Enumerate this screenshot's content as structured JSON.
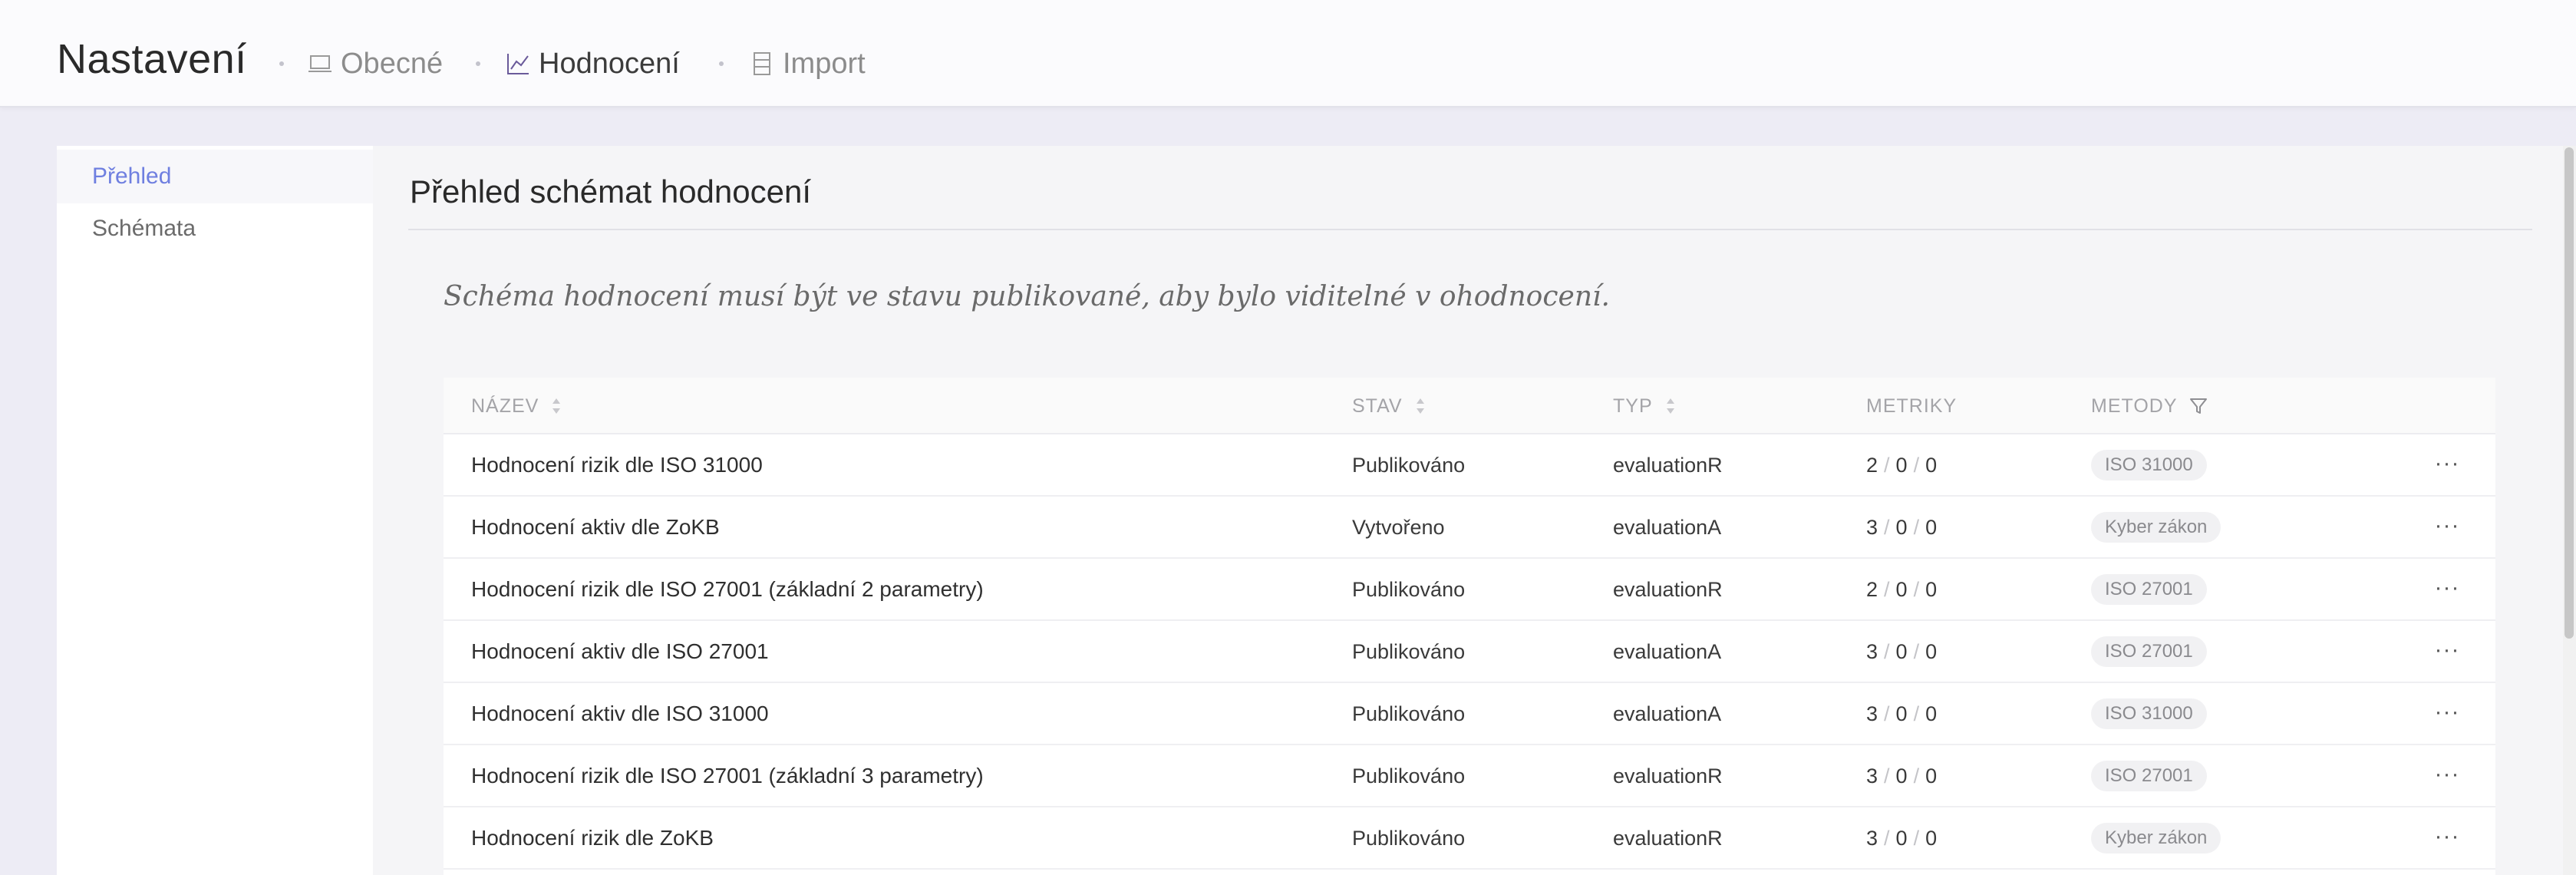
{
  "app": {
    "title": "Nastavení",
    "nav": [
      {
        "label": "Obecné",
        "icon": "laptop-icon",
        "active": false
      },
      {
        "label": "Hodnocení",
        "icon": "line-chart-icon",
        "active": true
      },
      {
        "label": "Import",
        "icon": "server-icon",
        "active": false
      }
    ]
  },
  "sidebar": {
    "items": [
      {
        "label": "Přehled",
        "active": true
      },
      {
        "label": "Schémata",
        "active": false
      }
    ]
  },
  "main": {
    "title": "Přehled schémat hodnocení",
    "notice": "Schéma hodnocení musí být ve stavu publikované, aby bylo viditelné v ohodnocení."
  },
  "table": {
    "columns": {
      "name": "NÁZEV",
      "status": "STAV",
      "type": "TYP",
      "metrics": "METRIKY",
      "methods": "METODY"
    },
    "rows": [
      {
        "name": "Hodnocení rizik dle ISO 31000",
        "status": "Publikováno",
        "type": "evaluationR",
        "m1": "2",
        "m2": "0",
        "m3": "0",
        "method": "ISO 31000",
        "more": "···"
      },
      {
        "name": "Hodnocení aktiv dle ZoKB",
        "status": "Vytvořeno",
        "type": "evaluationA",
        "m1": "3",
        "m2": "0",
        "m3": "0",
        "method": "Kyber zákon",
        "more": "···"
      },
      {
        "name": "Hodnocení rizik dle ISO 27001 (základní 2 parametry)",
        "status": "Publikováno",
        "type": "evaluationR",
        "m1": "2",
        "m2": "0",
        "m3": "0",
        "method": "ISO 27001",
        "more": "···"
      },
      {
        "name": "Hodnocení aktiv dle ISO 27001",
        "status": "Publikováno",
        "type": "evaluationA",
        "m1": "3",
        "m2": "0",
        "m3": "0",
        "method": "ISO 27001",
        "more": "···"
      },
      {
        "name": "Hodnocení aktiv dle ISO 31000",
        "status": "Publikováno",
        "type": "evaluationA",
        "m1": "3",
        "m2": "0",
        "m3": "0",
        "method": "ISO 31000",
        "more": "···"
      },
      {
        "name": "Hodnocení rizik dle ISO 27001 (základní 3 parametry)",
        "status": "Publikováno",
        "type": "evaluationR",
        "m1": "3",
        "m2": "0",
        "m3": "0",
        "method": "ISO 27001",
        "more": "···"
      },
      {
        "name": "Hodnocení rizik dle ZoKB",
        "status": "Publikováno",
        "type": "evaluationR",
        "m1": "3",
        "m2": "0",
        "m3": "0",
        "method": "Kyber zákon",
        "more": "···"
      }
    ]
  },
  "colors": {
    "accent": "#6f7fe0",
    "background": "#edecf5",
    "header": "#fbfbfd"
  }
}
